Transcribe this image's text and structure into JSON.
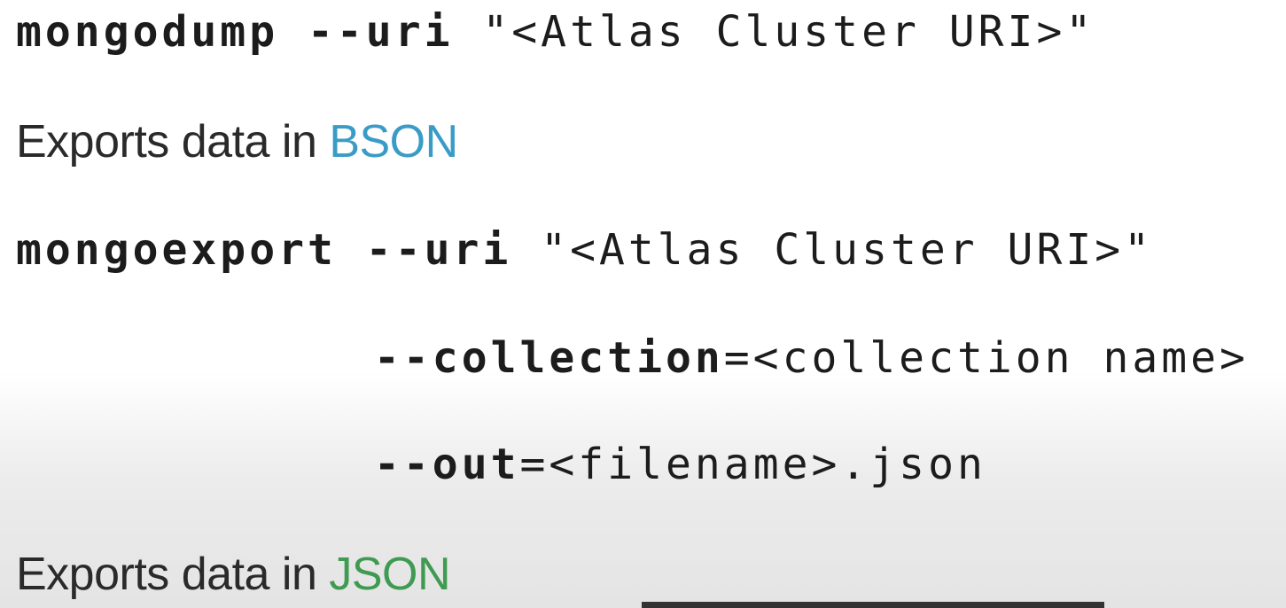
{
  "slide": {
    "line1": {
      "command": "mongodump",
      "option": " --uri",
      "argument": " \"<Atlas Cluster URI>\""
    },
    "line2": {
      "text": "Exports data in ",
      "format": "BSON",
      "format_color": "#3a9cc6"
    },
    "line3": {
      "command": "mongoexport",
      "option": " --uri",
      "argument": " \"<Atlas Cluster URI>\""
    },
    "line4": {
      "option": "--collection",
      "value": "=<collection name>"
    },
    "line5": {
      "option": "--out",
      "value": "=<filename>.json"
    },
    "line6": {
      "text": "Exports data in ",
      "format": "JSON",
      "format_color": "#3f9a52"
    }
  }
}
